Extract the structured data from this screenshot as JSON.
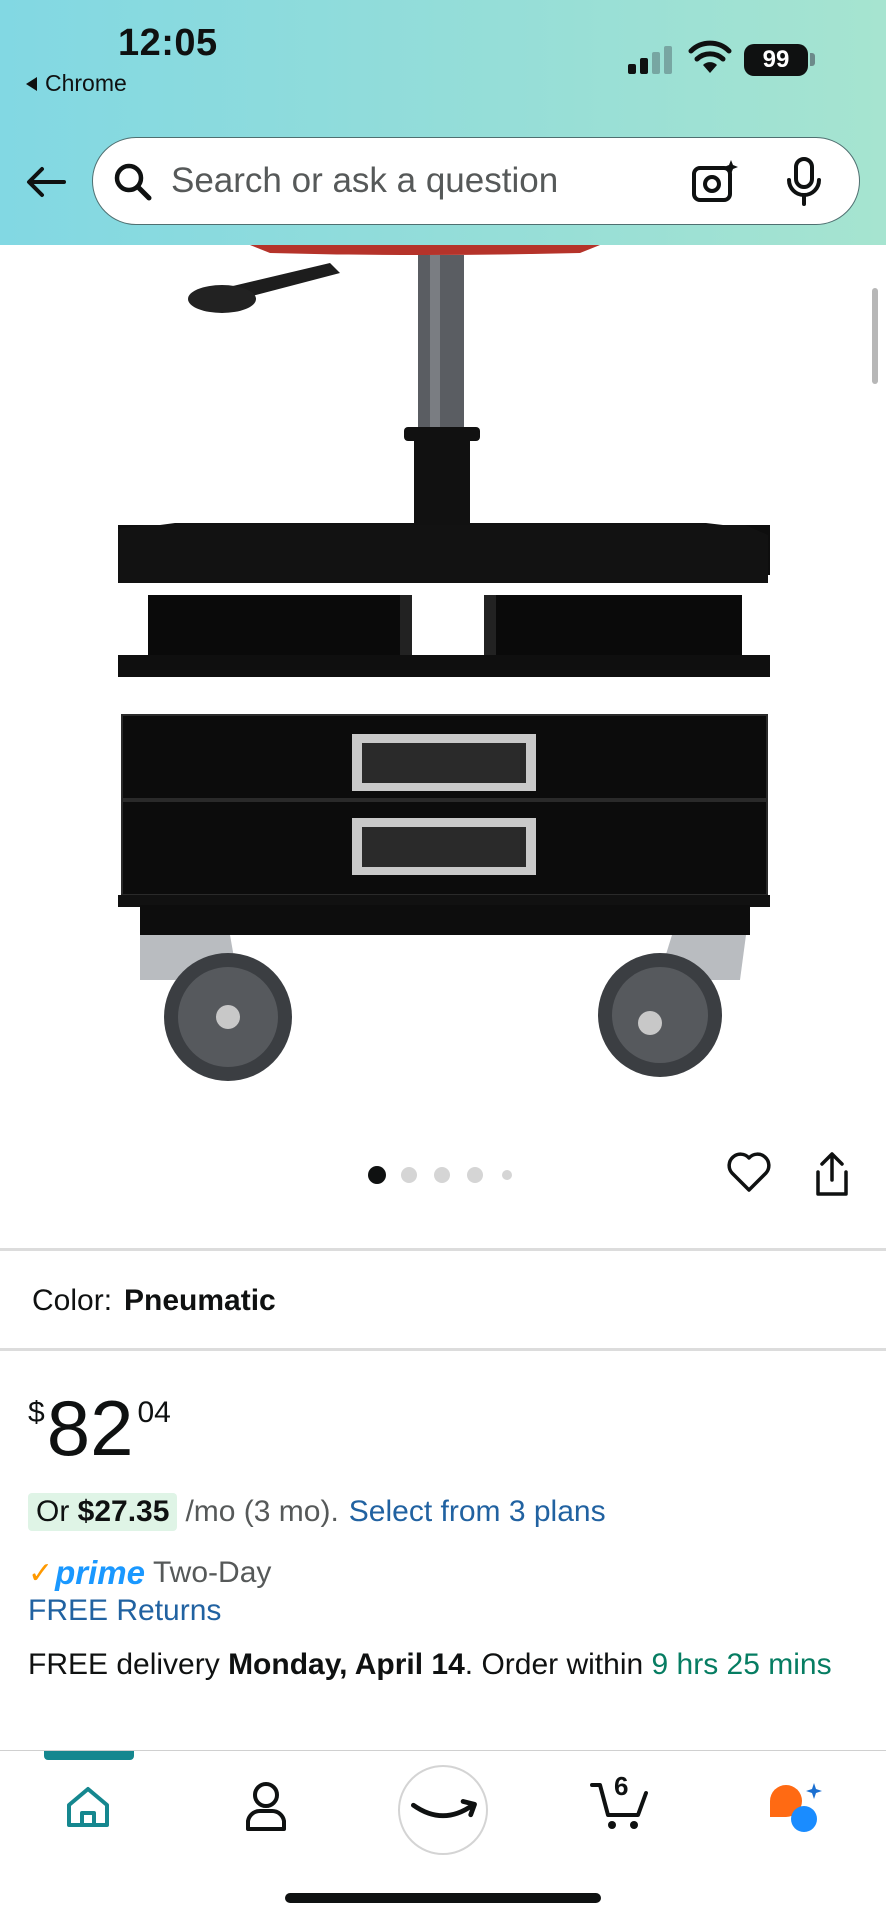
{
  "status_bar": {
    "time": "12:05",
    "back_app": "Chrome",
    "battery": "99"
  },
  "search": {
    "placeholder": "Search or ask a question"
  },
  "product": {
    "color_label": "Color:",
    "color_value": "Pneumatic",
    "image_count": 5,
    "active_image": 1
  },
  "price": {
    "symbol": "$",
    "whole": "82",
    "fraction": "04"
  },
  "installment": {
    "prefix": "Or ",
    "amount": "$27.35",
    "term": "/mo (3 mo).",
    "link": "Select from 3 plans"
  },
  "prime": {
    "check": "✓",
    "word": "prime",
    "speed": "Two-Day"
  },
  "returns": "FREE Returns",
  "delivery": {
    "prefix": "FREE delivery ",
    "date": "Monday, April 14",
    "middle": ". Order within ",
    "countdown": "9 hrs 25 mins"
  },
  "bottom_nav": {
    "cart_count": "6",
    "active": "home"
  },
  "colors": {
    "link": "#2162a1",
    "green": "#067d62",
    "prime": "#1a98ff",
    "accent": "#15878f"
  }
}
